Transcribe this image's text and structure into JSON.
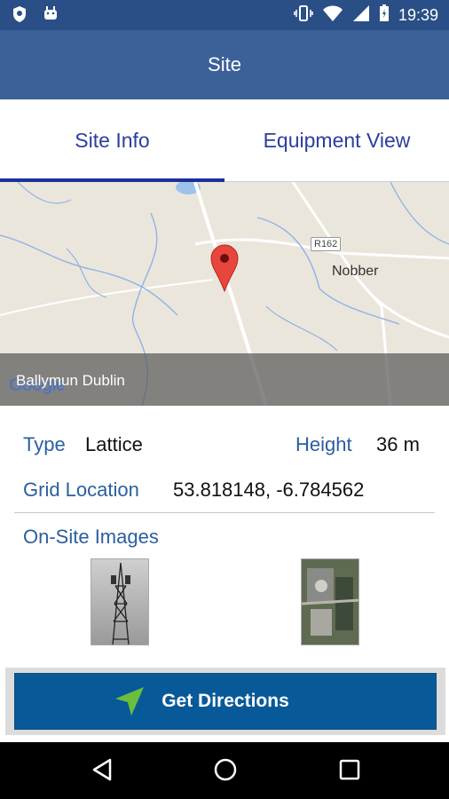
{
  "status_bar": {
    "time": "19:39",
    "left_icons": [
      "shield-icon",
      "android-icon"
    ],
    "right_icons": [
      "vibrate-icon",
      "wifi-icon",
      "signal-icon",
      "battery-icon"
    ]
  },
  "app_bar": {
    "title": "Site"
  },
  "tabs": [
    {
      "label": "Site Info",
      "active": true
    },
    {
      "label": "Equipment View",
      "active": false
    }
  ],
  "map": {
    "caption": "Ballymun Dublin",
    "road_label": "R162",
    "town_label": "Nobber",
    "attribution": "Google",
    "marker": "map-pin-icon"
  },
  "details": {
    "type_label": "Type",
    "type_value": "Lattice",
    "height_label": "Height",
    "height_value": "36 m",
    "grid_label": "Grid Location",
    "grid_value": "53.818148, -6.784562",
    "images_label": "On-Site Images"
  },
  "images": [
    "tower-photo",
    "aerial-photo"
  ],
  "button": {
    "label": "Get Directions"
  },
  "colors": {
    "status_bar": "#2a4f86",
    "app_bar": "#3b6199",
    "tab_text": "#2d3ea0",
    "label": "#2b5fa0",
    "button": "#075a97"
  }
}
